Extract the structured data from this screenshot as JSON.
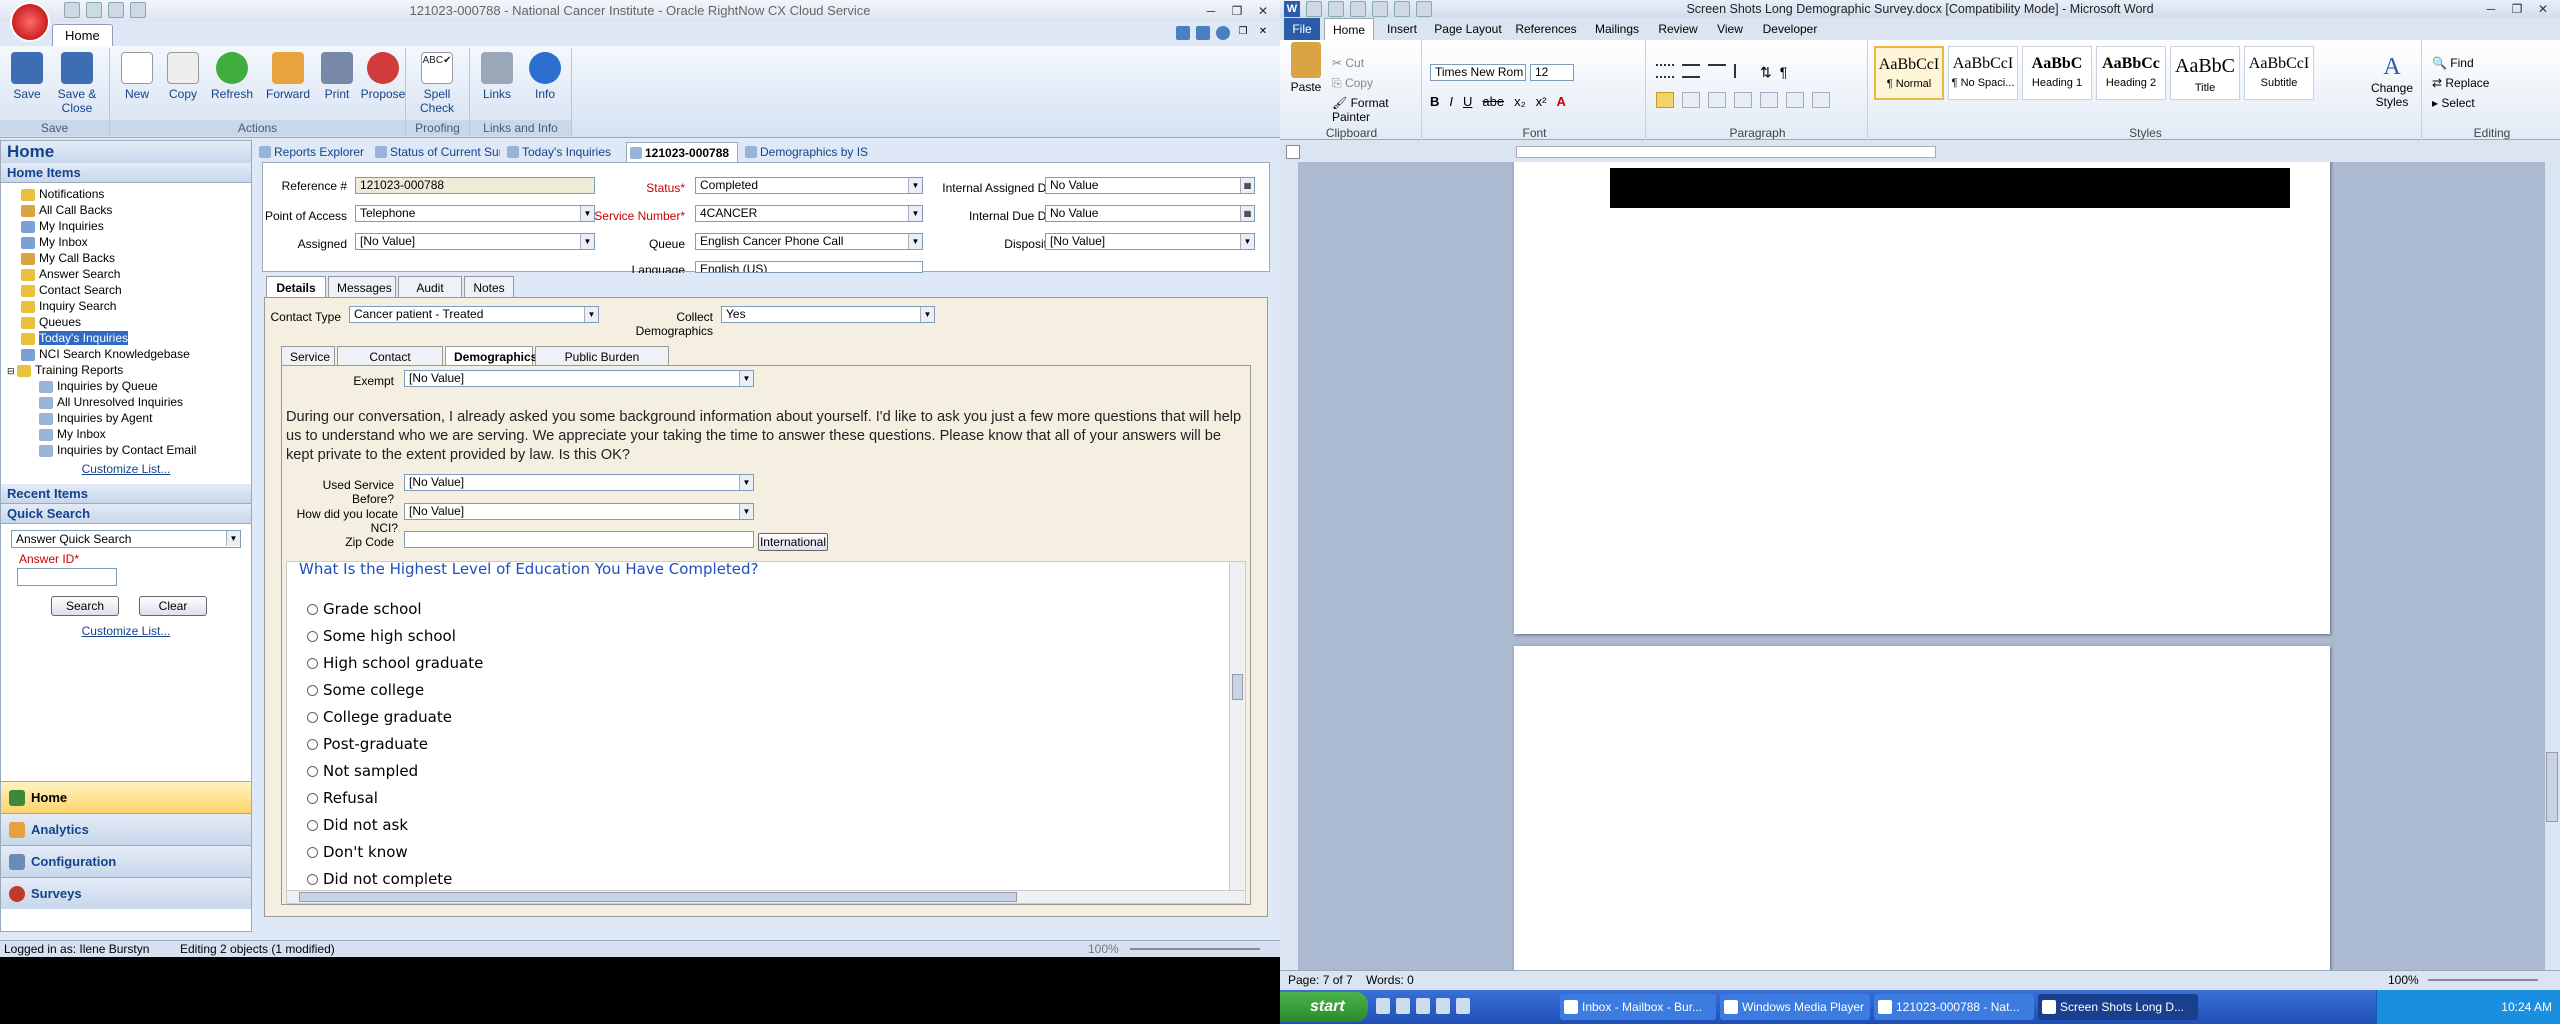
{
  "rn": {
    "title": "121023-000788 - National Cancer Institute - Oracle RightNow CX Cloud Service",
    "ribbon_tab": "Home",
    "groups": [
      {
        "label": "Save",
        "buttons": [
          "Save",
          "Save & Close"
        ]
      },
      {
        "label": "Actions",
        "buttons": [
          "New",
          "Copy",
          "Refresh",
          "Forward",
          "Print",
          "Propose"
        ]
      },
      {
        "label": "Proofing",
        "buttons": [
          "Spell Check"
        ]
      },
      {
        "label": "Links and Info",
        "buttons": [
          "Links",
          "Info"
        ]
      }
    ],
    "nav": {
      "home_title": "Home",
      "home_items_header": "Home Items",
      "items": [
        "Notifications",
        "All Call Backs",
        "My Inquiries",
        "My Inbox",
        "My Call Backs",
        "Answer Search",
        "Contact Search",
        "Inquiry Search",
        "Queues",
        "Today's Inquiries",
        "NCI Search Knowledgebase"
      ],
      "training_reports": "Training Reports",
      "training_items": [
        "Inquiries by Queue",
        "All Unresolved Inquiries",
        "Inquiries by Agent",
        "My Inbox",
        "Inquiries by Contact Email"
      ],
      "customize": "Customize List...",
      "recent_items": "Recent Items",
      "quick_search": "Quick Search",
      "quick_search_select": "Answer Quick Search",
      "answer_id_label": "Answer ID*",
      "search_btn": "Search",
      "clear_btn": "Clear",
      "customize2": "Customize List...",
      "bottom": [
        "Home",
        "Analytics",
        "Configuration",
        "Surveys"
      ]
    },
    "doc_tabs": [
      "Reports Explorer",
      "Status of Current Surveys",
      "Today's Inquiries",
      "121023-000788",
      "Demographics by IS"
    ],
    "form": {
      "reference_label": "Reference #",
      "reference": "121023-000788",
      "status_label": "Status*",
      "status": "Completed",
      "iad_label": "Internal Assigned Date",
      "iad": "No Value",
      "poa_label": "Point of Access",
      "poa": "Telephone",
      "sn_label": "Service Number*",
      "sn": "4CANCER",
      "idd_label": "Internal Due Date",
      "idd": "No Value",
      "assigned_label": "Assigned",
      "assigned": "[No Value]",
      "queue_label": "Queue",
      "queue": "English Cancer Phone Call",
      "disposition_label": "Disposition",
      "disposition": "[No Value]",
      "language_label": "Language",
      "language": "English (US)"
    },
    "detail_tabs": [
      "Details",
      "Messages",
      "Audit Log",
      "Notes"
    ],
    "contact_type_label": "Contact Type",
    "contact_type": "Cancer patient - Treated",
    "collect_label": "Collect Demographics",
    "collect": "Yes",
    "sub_tabs": [
      "Service",
      "Contact Information",
      "Demographics",
      "Public Burden Statement"
    ],
    "exempt_label": "Exempt",
    "exempt": "[No Value]",
    "intro": "During our conversation, I already asked you some background information about yourself. I'd like to ask you just a few more questions that will help us to understand who we are serving. We appreciate your taking the time to answer these questions. Please know that all of your answers will be kept private to the extent provided by law. Is this OK?",
    "used_label": "Used Service Before?",
    "used": "[No Value]",
    "locate_label": "How did you locate NCI?",
    "locate": "[No Value]",
    "zip_label": "Zip Code",
    "zip": "",
    "intl_btn": "International",
    "question": "What Is the Highest Level of Education You Have Completed?",
    "options": [
      "Grade school",
      "Some high school",
      "High school graduate",
      "Some college",
      "College graduate",
      "Post-graduate",
      "Not sampled",
      "Refusal",
      "Did not ask",
      "Don't know",
      "Did not complete"
    ],
    "status_bar": "Logged in as: Ilene Burstyn",
    "editing": "Editing 2 objects (1 modified)",
    "zoom": "100%"
  },
  "word": {
    "title": "Screen Shots Long Demographic Survey.docx [Compatibility Mode] - Microsoft Word",
    "tabs": [
      "File",
      "Home",
      "Insert",
      "Page Layout",
      "References",
      "Mailings",
      "Review",
      "View",
      "Developer"
    ],
    "clipboard": {
      "paste": "Paste",
      "cut": "Cut",
      "copy": "Copy",
      "format_painter": "Format Painter",
      "label": "Clipboard"
    },
    "font": {
      "name": "Times New Rom",
      "size": "12",
      "label": "Font"
    },
    "paragraph_label": "Paragraph",
    "styles": [
      {
        "preview": "AaBbCcI",
        "name": "¶ Normal"
      },
      {
        "preview": "AaBbCcI",
        "name": "¶ No Spaci..."
      },
      {
        "preview": "AaBbC",
        "name": "Heading 1"
      },
      {
        "preview": "AaBbCc",
        "name": "Heading 2"
      },
      {
        "preview": "AaBbC",
        "name": "Title"
      },
      {
        "preview": "AaBbCcI",
        "name": "Subtitle"
      }
    ],
    "styles_label": "Styles",
    "change_styles": "Change Styles",
    "editing": {
      "find": "Find",
      "replace": "Replace",
      "select": "Select",
      "label": "Editing"
    },
    "status": {
      "page": "Page: 7 of 7",
      "words": "Words: 0",
      "zoom": "100%"
    }
  },
  "taskbar": {
    "start": "start",
    "items": [
      "Inbox - Mailbox - Bur...",
      "Windows Media Player",
      "121023-000788 - Nat...",
      "Screen Shots Long D..."
    ],
    "time": "10:24 AM"
  }
}
